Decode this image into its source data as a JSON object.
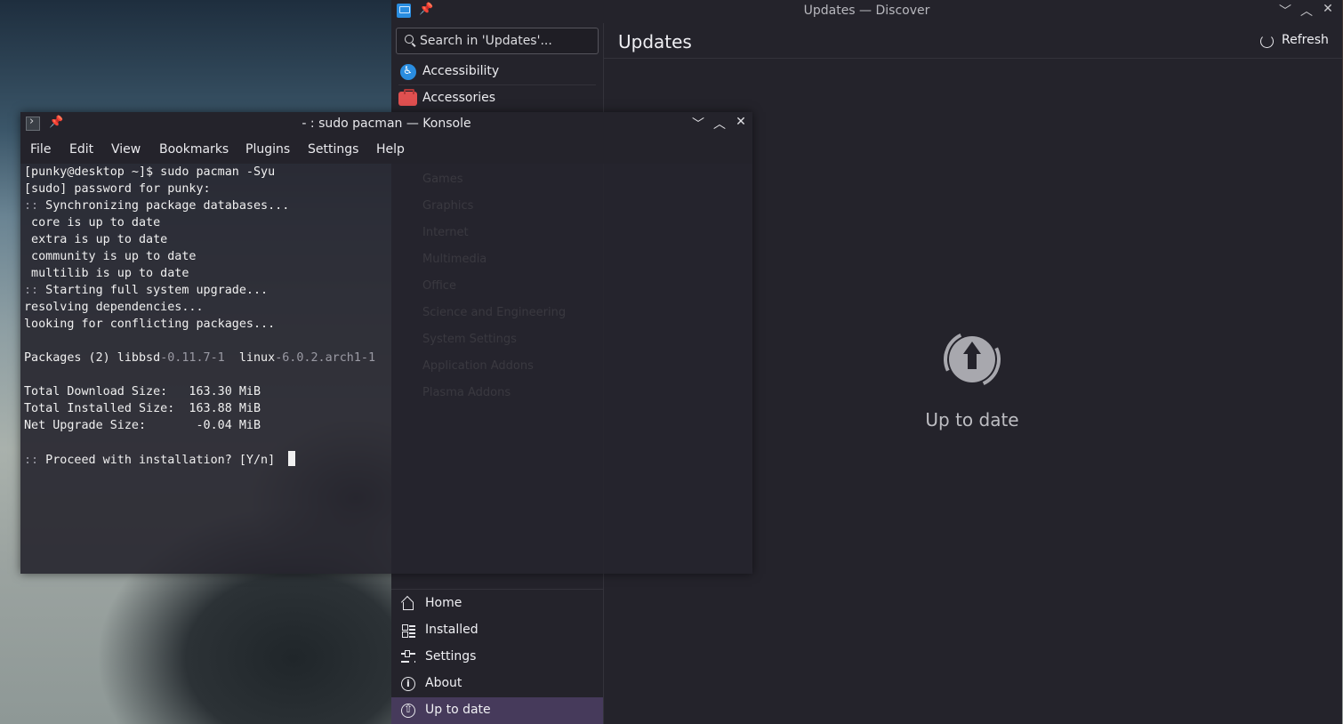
{
  "discover": {
    "window_title": "Updates — Discover",
    "search_placeholder": "Search in 'Updates'...",
    "categories": [
      {
        "label": "Accessibility",
        "icon": "accessibility-icon"
      },
      {
        "label": "Accessories",
        "icon": "toolbox-icon"
      }
    ],
    "hidden_categories": [
      "Games",
      "Graphics",
      "Internet",
      "Multimedia",
      "Office",
      "Science and Engineering",
      "System Settings",
      "Application Addons",
      "Plasma Addons"
    ],
    "nav": [
      {
        "label": "Home",
        "icon": "home-icon"
      },
      {
        "label": "Installed",
        "icon": "installed-icon"
      },
      {
        "label": "Settings",
        "icon": "settings-icon"
      },
      {
        "label": "About",
        "icon": "info-icon"
      },
      {
        "label": "Up to date",
        "icon": "update-icon",
        "active": true
      }
    ],
    "page_title": "Updates",
    "refresh_label": "Refresh",
    "status": "Up to date"
  },
  "konsole": {
    "window_title": "- : sudo pacman — Konsole",
    "menu": [
      "File",
      "Edit",
      "View",
      "Bookmarks",
      "Plugins",
      "Settings",
      "Help"
    ],
    "lines": {
      "l1": "[punky@desktop ~]$ sudo pacman -Syu",
      "l2": "[sudo] password for punky:",
      "l3a": "::",
      "l3b": " Synchronizing package databases...",
      "l4": " core is up to date",
      "l5": " extra is up to date",
      "l6": " community is up to date",
      "l7": " multilib is up to date",
      "l8a": "::",
      "l8b": " Starting full system upgrade...",
      "l9": "resolving dependencies...",
      "l10": "looking for conflicting packages...",
      "l11a": "Packages (2) libbsd",
      "l11b": "-0.11.7-1",
      "l11c": "  linux",
      "l11d": "-6.0.2.arch1-1",
      "l12": "Total Download Size:   163.30 MiB",
      "l13": "Total Installed Size:  163.88 MiB",
      "l14": "Net Upgrade Size:       -0.04 MiB",
      "l15a": "::",
      "l15b": " Proceed with installation? [Y/n] "
    }
  },
  "colors": {
    "active_nav": "#463a5b",
    "window_bg": "#24232b",
    "accent_blue": "#2a8de0"
  }
}
